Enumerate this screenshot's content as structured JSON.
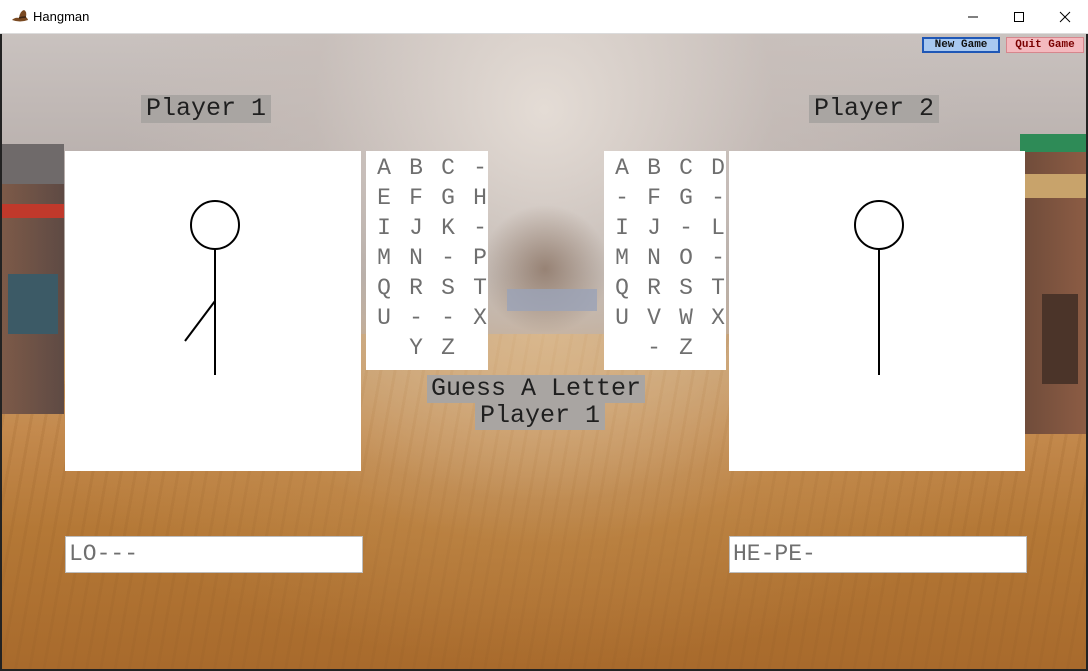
{
  "window": {
    "title": "Hangman",
    "app_icon": "hat-icon",
    "controls": [
      "minimize-icon",
      "maximize-icon",
      "close-icon"
    ]
  },
  "toolbar": {
    "new_game_label": "New Game",
    "quit_game_label": "Quit Game",
    "new_game_color": "#a8c8f0",
    "quit_game_color": "#f4b9be"
  },
  "player1": {
    "label": "Player 1",
    "word": "LO---",
    "letters": [
      "A",
      "B",
      "C",
      "-",
      "E",
      "F",
      "G",
      "H",
      "I",
      "J",
      "K",
      "-",
      "M",
      "N",
      "-",
      "P",
      "Q",
      "R",
      "S",
      "T",
      "U",
      "-",
      "-",
      "X",
      "",
      "Y",
      "Z",
      ""
    ],
    "hangman_parts": [
      "head",
      "body",
      "left-leg"
    ]
  },
  "player2": {
    "label": "Player 2",
    "word": "HE-PE-",
    "letters": [
      "A",
      "B",
      "C",
      "D",
      "-",
      "F",
      "G",
      "-",
      "I",
      "J",
      "-",
      "L",
      "M",
      "N",
      "O",
      "-",
      "Q",
      "R",
      "S",
      "T",
      "U",
      "V",
      "W",
      "X",
      "",
      "-",
      "Z",
      ""
    ],
    "hangman_parts": [
      "head",
      "body"
    ]
  },
  "prompt": {
    "line1": "Guess A Letter",
    "line2": "Player 1"
  }
}
